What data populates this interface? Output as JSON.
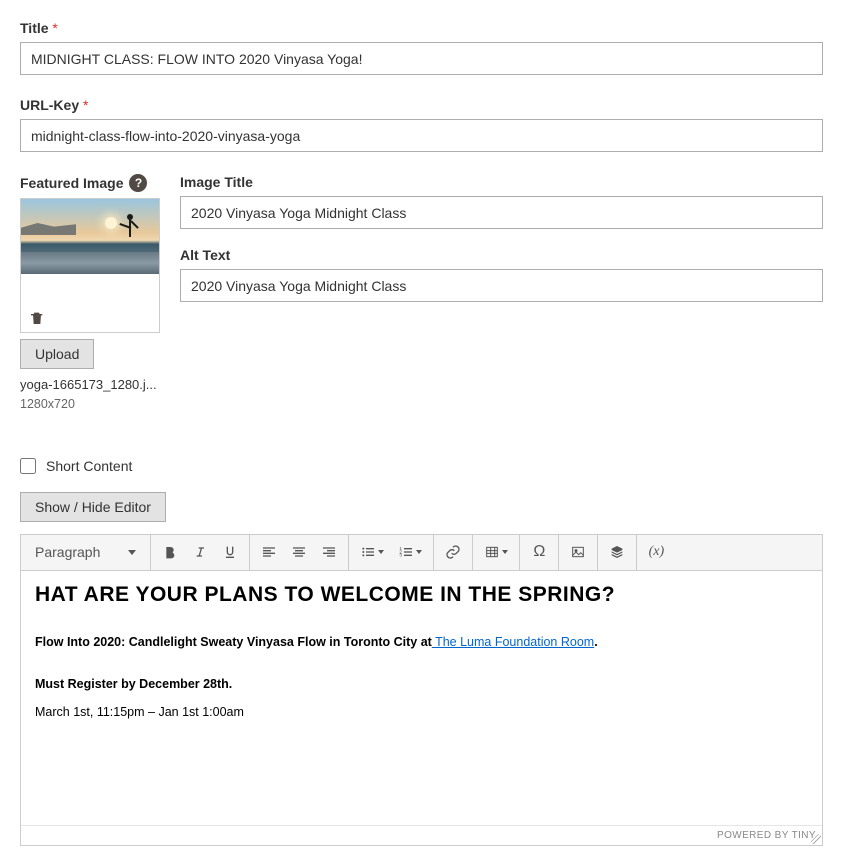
{
  "fields": {
    "title_label": "Title",
    "title_value": "MIDNIGHT CLASS: FLOW INTO 2020 Vinyasa Yoga!",
    "urlkey_label": "URL-Key",
    "urlkey_value": "midnight-class-flow-into-2020-vinyasa-yoga",
    "featured_image_label": "Featured Image",
    "image_title_label": "Image Title",
    "image_title_value": "2020 Vinyasa Yoga Midnight Class",
    "alt_text_label": "Alt Text",
    "alt_text_value": "2020 Vinyasa Yoga Midnight Class",
    "upload_button": "Upload",
    "file_name": "yoga-1665173_1280.j...",
    "file_dimensions": "1280x720",
    "short_content_label": "Short Content",
    "toggle_editor_button": "Show / Hide Editor"
  },
  "editor": {
    "format_label": "Paragraph",
    "powered_by": "POWERED BY TINY",
    "content": {
      "heading": "HAT ARE YOUR PLANS TO WELCOME IN THE SPRING?",
      "p1_pre": "Flow Into 2020: Candlelight Sweaty Vinyasa Flow in Toronto City at",
      "p1_link": " The Luma Foundation Room",
      "p1_post": ".",
      "p2": "Must Register by December 28th.",
      "p3": "March 1st, 11:15pm – Jan 1st 1:00am"
    }
  }
}
